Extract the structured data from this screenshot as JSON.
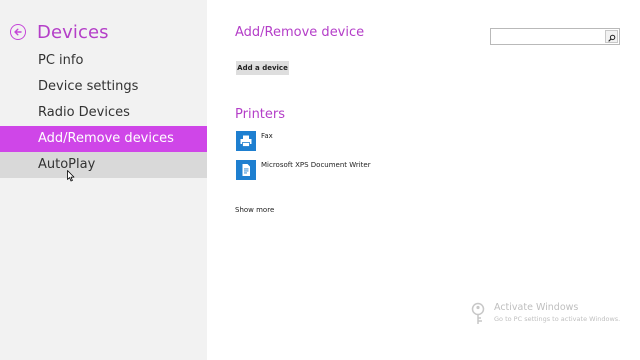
{
  "nav": {
    "title": "Devices",
    "items": [
      {
        "label": "PC info"
      },
      {
        "label": "Device settings"
      },
      {
        "label": "Radio Devices"
      },
      {
        "label": "Add/Remove devices"
      },
      {
        "label": "AutoPlay"
      }
    ],
    "selected_index": 3,
    "hover_index": 4
  },
  "main": {
    "section_title": "Add/Remove device",
    "add_button_label": "Add a device",
    "printers_title": "Printers",
    "printers": [
      {
        "name": "Fax",
        "icon": "fax-icon"
      },
      {
        "name": "Microsoft XPS Document Writer",
        "icon": "document-printer-icon"
      }
    ],
    "show_more_label": "Show more"
  },
  "search": {
    "value": "",
    "placeholder": ""
  },
  "watermark": {
    "title": "Activate Windows",
    "subtitle": "Go to PC settings to activate Windows."
  },
  "colors": {
    "accent": "#b43ec8",
    "selected_bg": "#cf46e8",
    "hover_bg": "#d9d9d9",
    "nav_bg": "#f2f2f2",
    "printer_icon_bg": "#1e7fd0"
  }
}
